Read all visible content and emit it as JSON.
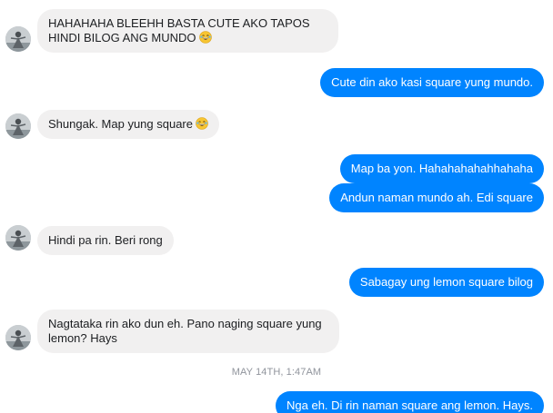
{
  "messages": [
    {
      "side": "in",
      "text": "HAHAHAHA BLEEHH BASTA CUTE AKO TAPOS HINDI BILOG ANG MUNDO",
      "emoji": "laughing-emoji"
    },
    {
      "side": "out",
      "text": "Cute din ako kasi square yung mundo."
    },
    {
      "side": "in",
      "text": "Shungak. Map yung square",
      "emoji": "laughing-emoji"
    },
    {
      "side": "out",
      "text": "Map ba yon. Hahahahahahhahaha"
    },
    {
      "side": "out",
      "text": "Andun naman mundo ah. Edi square"
    },
    {
      "side": "in",
      "text": "Hindi pa rin. Beri rong"
    },
    {
      "side": "out",
      "text": "Sabagay ung lemon square bilog"
    },
    {
      "side": "in",
      "text": "Nagtataka rin ako dun eh. Pano naging square yung lemon? Hays"
    },
    {
      "side": "out",
      "text": "Nga eh. Di rin naman square ang lemon. Hays."
    }
  ],
  "timestamp": "MAY 14TH, 1:47AM",
  "colors": {
    "outgoing_bubble": "#0084ff",
    "incoming_bubble": "#f1f0f0",
    "timestamp_text": "#90949c"
  }
}
